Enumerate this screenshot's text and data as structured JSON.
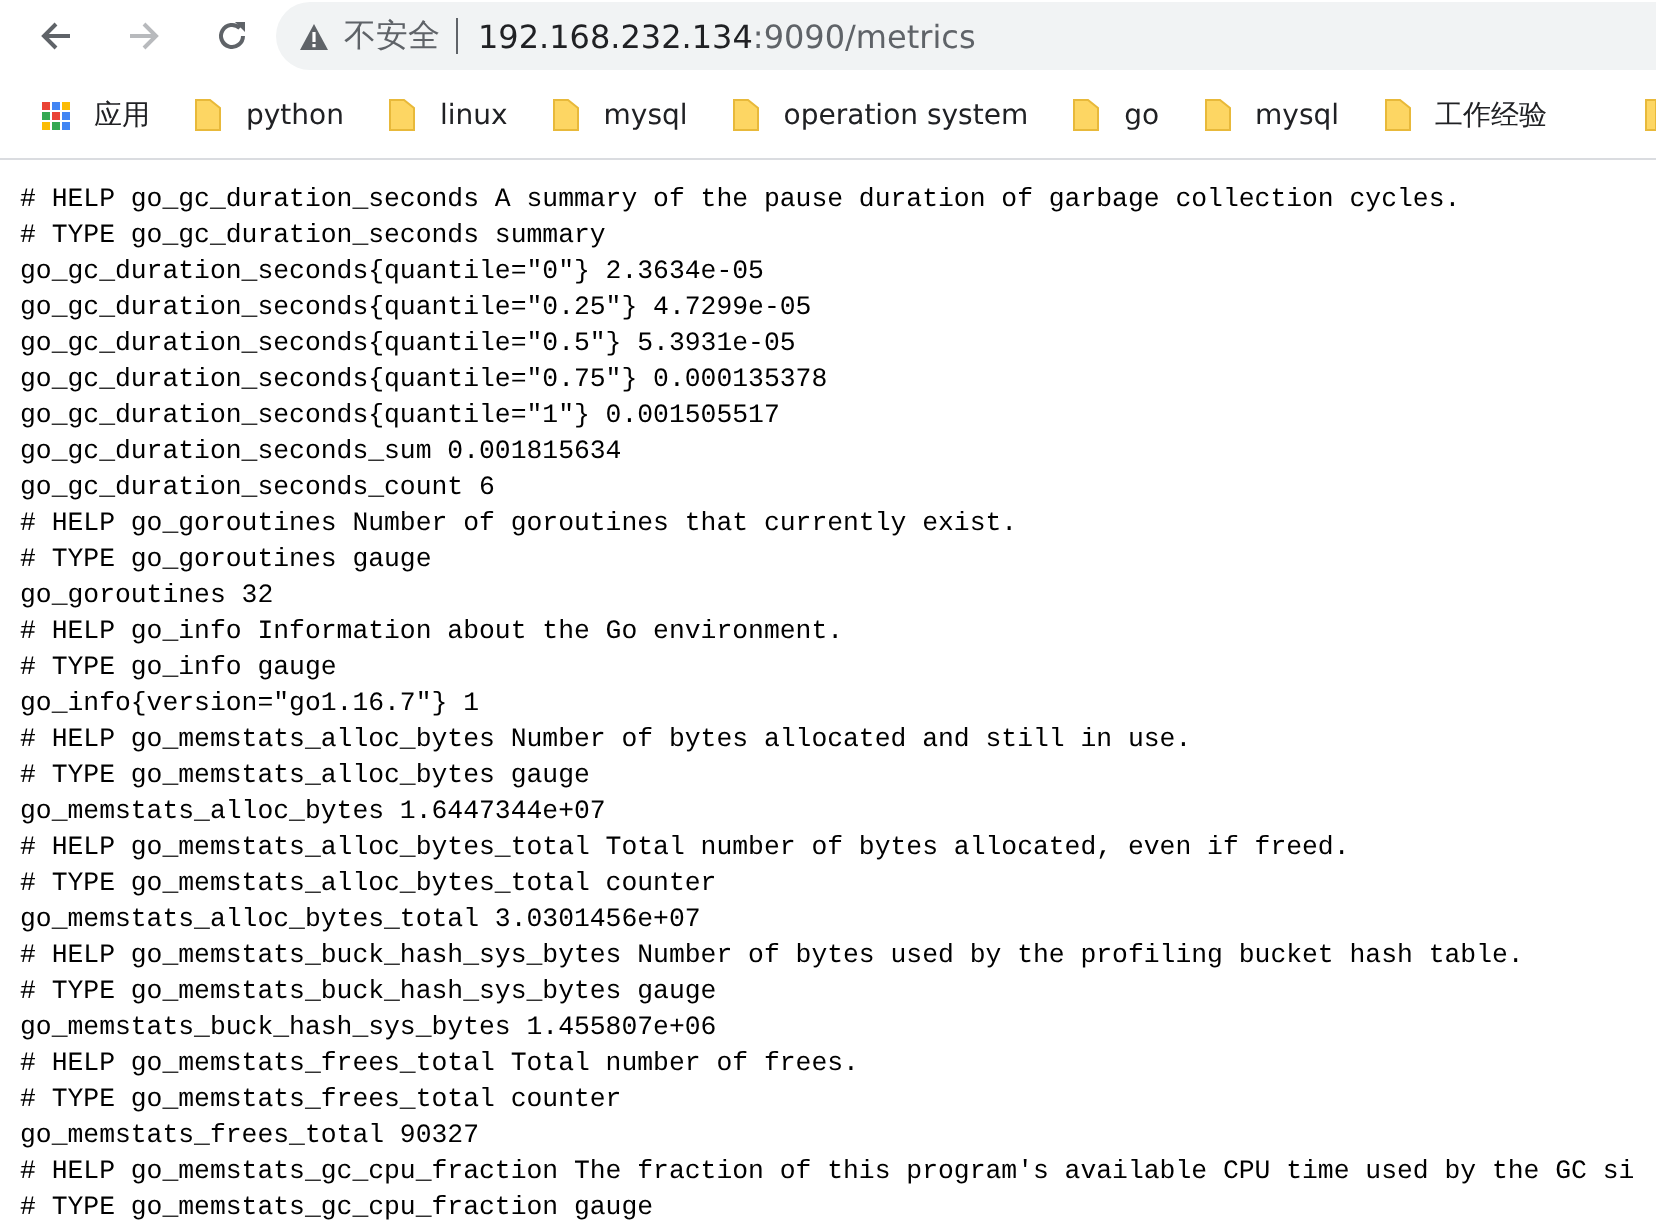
{
  "toolbar": {
    "security_label": "不安全",
    "url_host": "192.168.232.134",
    "url_rest": ":9090/metrics"
  },
  "bookmarks": [
    {
      "label": "应用",
      "kind": "apps"
    },
    {
      "label": "python",
      "kind": "folder"
    },
    {
      "label": "linux",
      "kind": "folder"
    },
    {
      "label": "mysql",
      "kind": "folder"
    },
    {
      "label": "operation system",
      "kind": "folder"
    },
    {
      "label": "go",
      "kind": "folder"
    },
    {
      "label": "mysql",
      "kind": "folder"
    },
    {
      "label": "工作经验",
      "kind": "folder"
    }
  ],
  "content_lines": [
    "# HELP go_gc_duration_seconds A summary of the pause duration of garbage collection cycles.",
    "# TYPE go_gc_duration_seconds summary",
    "go_gc_duration_seconds{quantile=\"0\"} 2.3634e-05",
    "go_gc_duration_seconds{quantile=\"0.25\"} 4.7299e-05",
    "go_gc_duration_seconds{quantile=\"0.5\"} 5.3931e-05",
    "go_gc_duration_seconds{quantile=\"0.75\"} 0.000135378",
    "go_gc_duration_seconds{quantile=\"1\"} 0.001505517",
    "go_gc_duration_seconds_sum 0.001815634",
    "go_gc_duration_seconds_count 6",
    "# HELP go_goroutines Number of goroutines that currently exist.",
    "# TYPE go_goroutines gauge",
    "go_goroutines 32",
    "# HELP go_info Information about the Go environment.",
    "# TYPE go_info gauge",
    "go_info{version=\"go1.16.7\"} 1",
    "# HELP go_memstats_alloc_bytes Number of bytes allocated and still in use.",
    "# TYPE go_memstats_alloc_bytes gauge",
    "go_memstats_alloc_bytes 1.6447344e+07",
    "# HELP go_memstats_alloc_bytes_total Total number of bytes allocated, even if freed.",
    "# TYPE go_memstats_alloc_bytes_total counter",
    "go_memstats_alloc_bytes_total 3.0301456e+07",
    "# HELP go_memstats_buck_hash_sys_bytes Number of bytes used by the profiling bucket hash table.",
    "# TYPE go_memstats_buck_hash_sys_bytes gauge",
    "go_memstats_buck_hash_sys_bytes 1.455807e+06",
    "# HELP go_memstats_frees_total Total number of frees.",
    "# TYPE go_memstats_frees_total counter",
    "go_memstats_frees_total 90327",
    "# HELP go_memstats_gc_cpu_fraction The fraction of this program's available CPU time used by the GC si",
    "# TYPE go_memstats_gc_cpu_fraction gauge"
  ]
}
